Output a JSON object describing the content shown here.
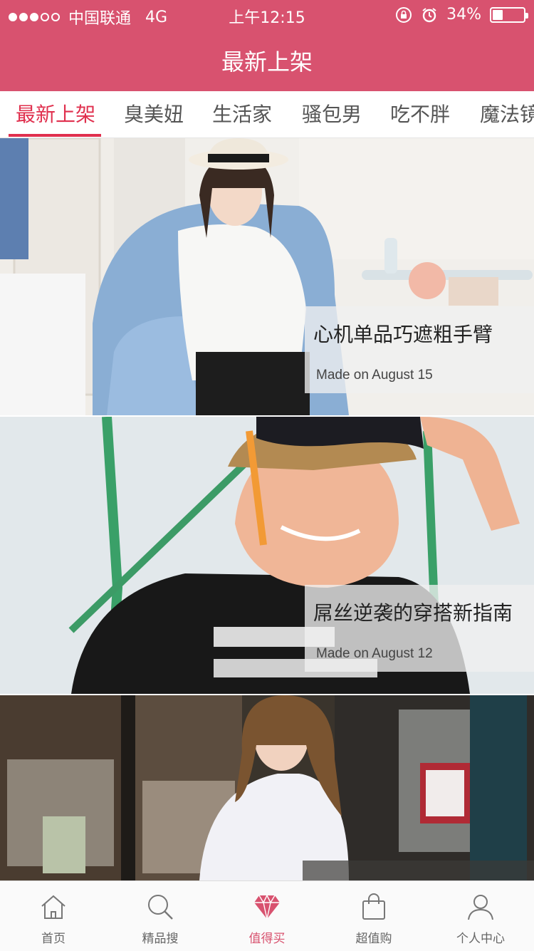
{
  "status_bar": {
    "carrier": "中国联通",
    "network": "4G",
    "time": "上午12:15",
    "battery_text": "34%",
    "battery_level": 0.34,
    "icons": [
      "rotation-lock-icon",
      "alarm-icon",
      "battery-icon"
    ]
  },
  "header": {
    "title": "最新上架",
    "background_color": "#d8526f"
  },
  "tabs": {
    "active_color": "#e0304e",
    "items": [
      {
        "label": "最新上架",
        "active": true
      },
      {
        "label": "臭美妞",
        "active": false
      },
      {
        "label": "生活家",
        "active": false
      },
      {
        "label": "骚包男",
        "active": false
      },
      {
        "label": "吃不胖",
        "active": false
      },
      {
        "label": "魔法镜",
        "active": false
      }
    ]
  },
  "feed": {
    "items": [
      {
        "title": "心机单品巧遮粗手臂",
        "date": "Made on August 15"
      },
      {
        "title": "屌丝逆袭的穿搭新指南",
        "date": "Made on August 12"
      },
      {
        "title": "",
        "date": ""
      }
    ]
  },
  "bottom_nav": {
    "items": [
      {
        "label": "首页",
        "icon": "home-icon",
        "active": false
      },
      {
        "label": "精品搜",
        "icon": "search-icon",
        "active": false
      },
      {
        "label": "值得买",
        "icon": "diamond-icon",
        "active": true
      },
      {
        "label": "超值购",
        "icon": "shopping-bag-icon",
        "active": false
      },
      {
        "label": "个人中心",
        "icon": "user-icon",
        "active": false
      }
    ]
  }
}
